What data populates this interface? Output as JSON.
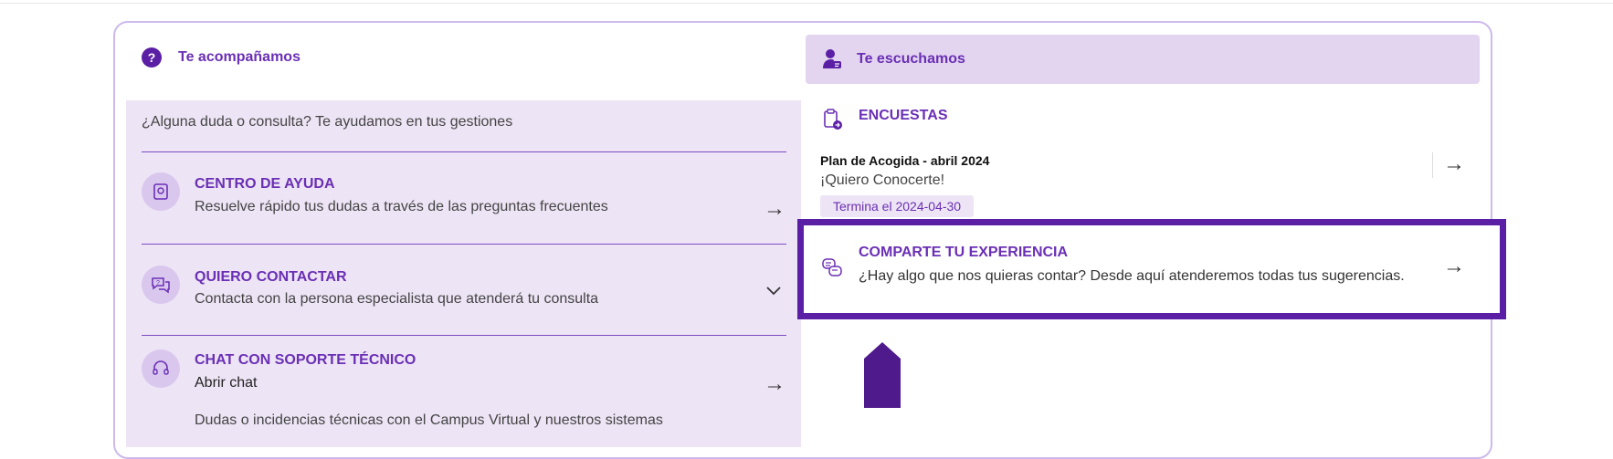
{
  "left": {
    "header": "Te acompañamos",
    "intro": "¿Alguna duda o consulta? Te ayudamos en tus gestiones",
    "rows": [
      {
        "title": "CENTRO DE AYUDA",
        "subtitle": "Resuelve rápido tus dudas a través de las preguntas frecuentes"
      },
      {
        "title": "QUIERO CONTACTAR",
        "subtitle": "Contacta con la persona especialista que atenderá tu consulta"
      },
      {
        "title": "CHAT CON SOPORTE TÉCNICO",
        "subtitle": "Abrir chat",
        "detail": "Dudas o incidencias técnicas con el Campus Virtual y nuestros sistemas"
      }
    ]
  },
  "right": {
    "header": "Te escuchamos",
    "surveys_title": "ENCUESTAS",
    "survey": {
      "name": "Plan de Acogida - abril 2024",
      "subtitle": "¡Quiero Conocerte!",
      "badge": "Termina el 2024-04-30"
    },
    "share": {
      "title": "COMPARTE TU EXPERIENCIA",
      "subtitle": "¿Hay algo que nos quieras contar? Desde aquí atenderemos todas tus sugerencias."
    }
  },
  "colors": {
    "accent": "#6a2fb5",
    "highlight_border": "#5b1fa5",
    "panel_bg": "#ede4f5",
    "header_bg": "#e3d4ef"
  }
}
